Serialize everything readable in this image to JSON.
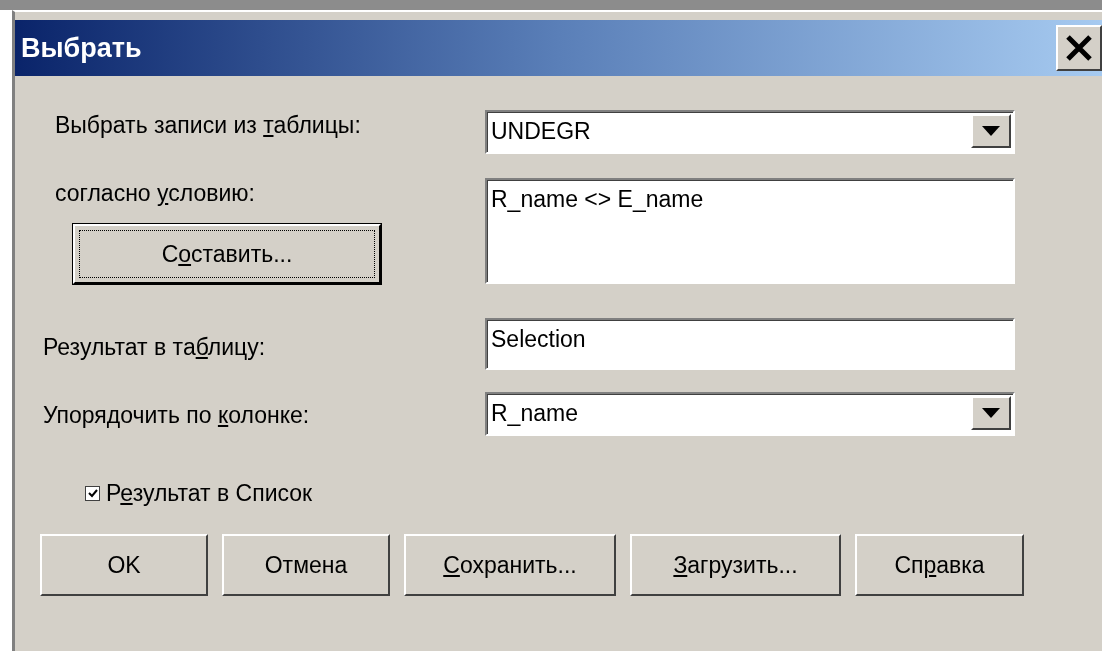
{
  "window": {
    "title": "Выбрать"
  },
  "table_field": {
    "label": {
      "pre": "Выбрать записи из ",
      "key": "т",
      "post": "аблицы:"
    },
    "value": "UNDEGR"
  },
  "condition": {
    "label": {
      "pre": "согласно ",
      "key": "у",
      "post": "словию:"
    },
    "value": "R_name <> E_name",
    "compose_button": {
      "pre": "С",
      "key": "о",
      "post": "ставить..."
    }
  },
  "result_table": {
    "label": {
      "pre": "Результат в та",
      "key": "б",
      "post": "лицу:"
    },
    "value": "Selection"
  },
  "order_by": {
    "label": {
      "pre": "Упорядочить по ",
      "key": "к",
      "post": "олонке:"
    },
    "value": "R_name"
  },
  "result_list": {
    "label": {
      "pre": "Р",
      "key": "е",
      "post": "зультат в Список"
    },
    "checked": true
  },
  "buttons": [
    {
      "label": {
        "pre": "OK"
      }
    },
    {
      "label": {
        "pre": "Отмена"
      }
    },
    {
      "label": {
        "key": "С",
        "post": "охранить..."
      }
    },
    {
      "label": {
        "key": "З",
        "post": "агрузить..."
      }
    },
    {
      "label": {
        "pre": "Сп",
        "key": "р",
        "post": "авка"
      }
    }
  ]
}
